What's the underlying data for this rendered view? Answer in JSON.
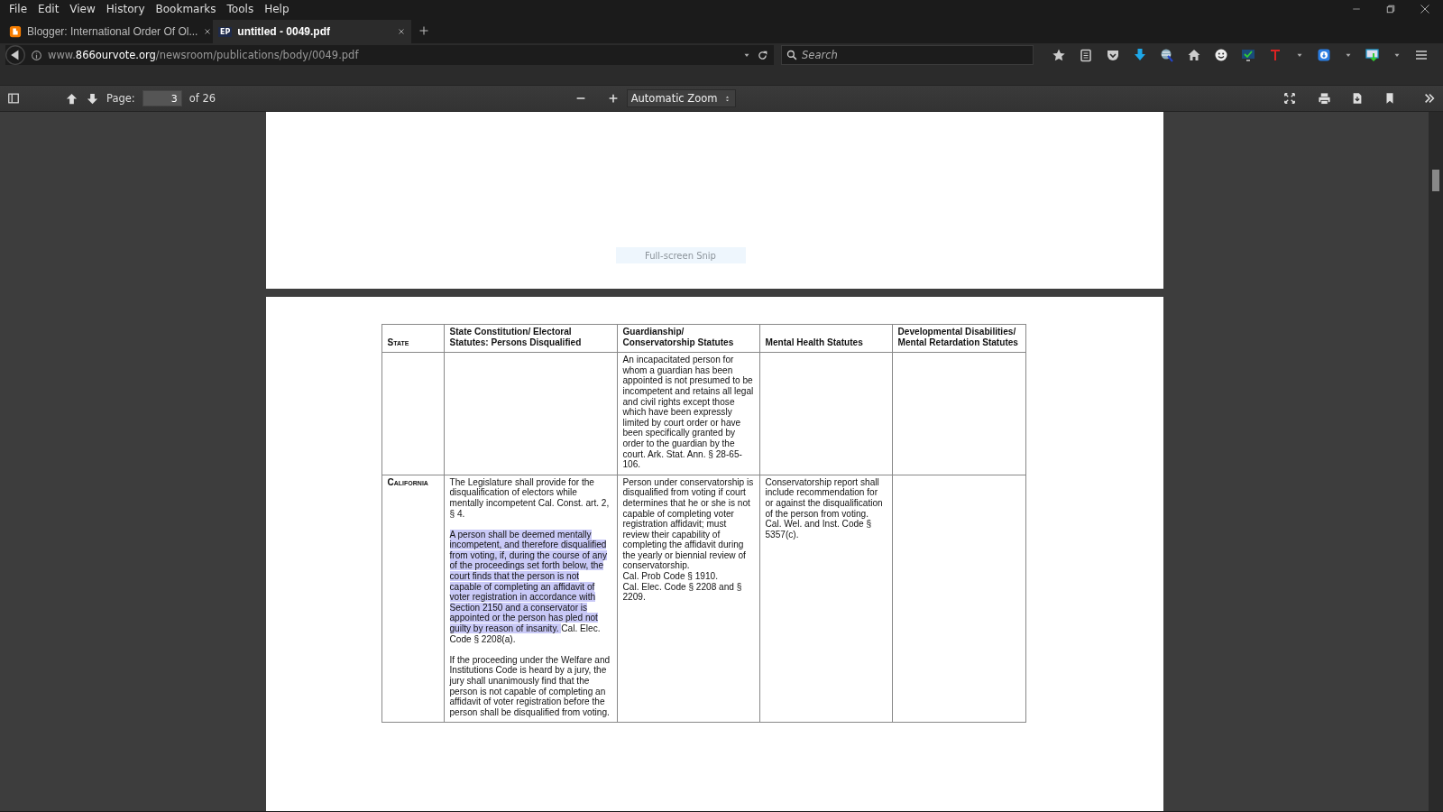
{
  "menu": [
    "File",
    "Edit",
    "View",
    "History",
    "Bookmarks",
    "Tools",
    "Help"
  ],
  "tabs": [
    {
      "title": "Blogger: International Order Of Ol...",
      "selected": false
    },
    {
      "title": "untitled - 0049.pdf",
      "badge": "EP",
      "selected": true
    }
  ],
  "address": {
    "prefix": "www.",
    "domain": "866ourvote.org",
    "path": "/newsroom/publications/body/0049.pdf"
  },
  "search": {
    "placeholder": "Search"
  },
  "pdf_toolbar": {
    "page_label": "Page:",
    "page": "3",
    "page_count": "of 26",
    "zoom": "Automatic Zoom"
  },
  "overlay": {
    "text": "Full-screen Snip"
  },
  "table": {
    "columns": [
      "State",
      "State Constitution/ Electoral Statutes:  Persons Disqualified",
      "Guardianship/ Conservatorship Statutes",
      "Mental Health Statutes",
      "Developmental Disabilities/ Mental Retardation Statutes"
    ],
    "rows": [
      {
        "guardianship": [
          {
            "text": "An incapacitated person for whom a guardian has been appointed is not presumed to be incompetent and retains all legal and civil rights except those which have been expressly limited by court order or have been specifically granted by order to the guardian by the court.  Ark. Stat. Ann. § 28-65-106."
          }
        ]
      },
      {
        "state": "California",
        "constitution": [
          {
            "text": "The Legislature shall provide for the disqualification of electors while mentally incompetent Cal. Const. art. 2, § 4."
          },
          {
            "highlighted": "A person shall be deemed mentally incompetent, and therefore disqualified from voting, if, during the course of any of the proceedings set forth below, the court finds that the person is not capable of completing an affidavit of voter registration in accordance with Section 2150 and a conservator is appointed or the person has pled not guilty by reason of insanity. ",
            "text": " Cal. Elec. Code § 2208(a)."
          },
          {
            "text": "If the proceeding under the Welfare and Institutions Code is heard by a jury, the jury shall unanimously find that the person is not capable of completing an affidavit of voter registration before the person shall be disqualified from voting."
          }
        ],
        "guardianship": [
          {
            "text": "Person under conservatorship is disqualified from voting if court determines that he or she is not capable of completing voter registration affidavit; must review their capability of completing the affidavit during the yearly or biennial review of conservatorship.\nCal. Prob Code § 1910.\nCal. Elec. Code § 2208 and § 2209."
          }
        ],
        "mental_health": [
          {
            "text": "Conservatorship report shall include recommendation for or against the disqualification of the person from voting. Cal. Wel. and Inst. Code § 5357(c)."
          }
        ]
      }
    ]
  }
}
